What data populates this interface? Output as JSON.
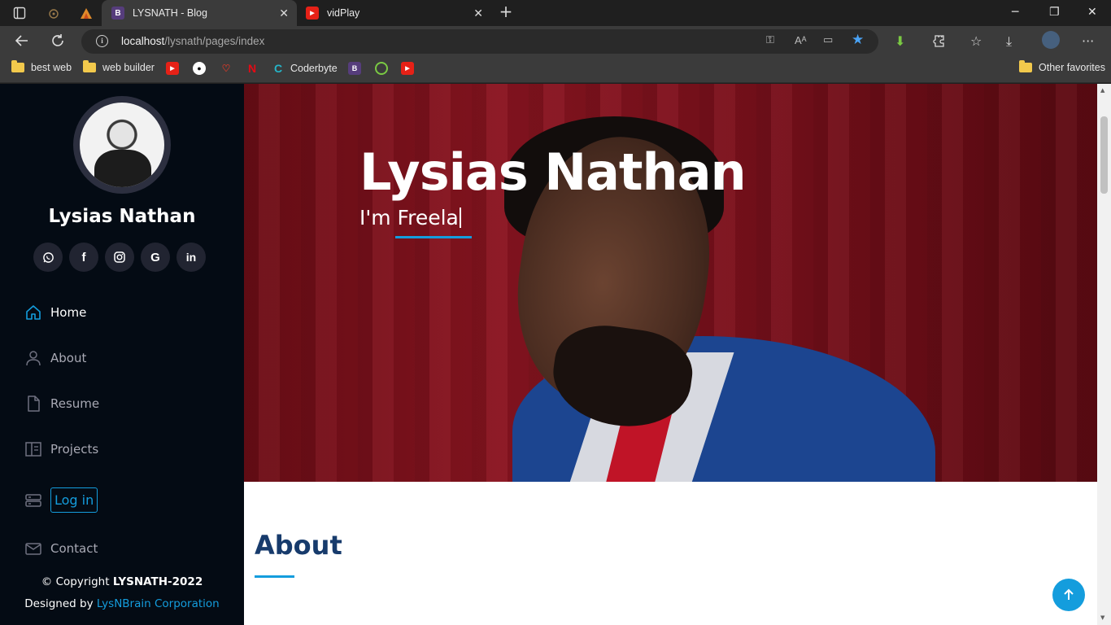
{
  "browser": {
    "tabs": [
      {
        "title": "LYSNATH - Blog",
        "favicon": "B",
        "active": true
      },
      {
        "title": "vidPlay",
        "favicon": "▶",
        "active": false
      }
    ],
    "url_host": "localhost",
    "url_path": "/lysnath/pages/index",
    "bookmarks": [
      {
        "label": "best web",
        "icon": "folder-icon"
      },
      {
        "label": "web builder",
        "icon": "folder-icon"
      },
      {
        "label": "",
        "icon": "youtube-icon"
      },
      {
        "label": "",
        "icon": "github-icon"
      },
      {
        "label": "",
        "icon": "bookmark-icon"
      },
      {
        "label": "",
        "icon": "netflix-icon"
      },
      {
        "label": "Coderbyte",
        "icon": "coderbyte-icon"
      },
      {
        "label": "",
        "icon": "bootstrap-icon"
      },
      {
        "label": "",
        "icon": "site-icon"
      },
      {
        "label": "",
        "icon": "youtube-icon"
      }
    ],
    "other_favorites": "Other favorites"
  },
  "sidebar": {
    "name": "Lysias Nathan",
    "socials": [
      "whatsapp-icon",
      "facebook-icon",
      "instagram-icon",
      "google-icon",
      "linkedin-icon"
    ],
    "nav": {
      "home": "Home",
      "about": "About",
      "resume": "Resume",
      "projects": "Projects",
      "login": "Log in",
      "contact": "Contact"
    },
    "copyright_prefix": "© Copyright ",
    "copyright_brand": "LYSNATH-2022",
    "designed_prefix": "Designed by ",
    "designed_link": "LysNBrain Corporation"
  },
  "hero": {
    "title": "Lysias Nathan",
    "subtitle": "I'm Freela"
  },
  "about": {
    "title": "About"
  },
  "colors": {
    "accent": "#149ddd",
    "sidebar_bg": "#040b14",
    "heading": "#173b6c"
  }
}
